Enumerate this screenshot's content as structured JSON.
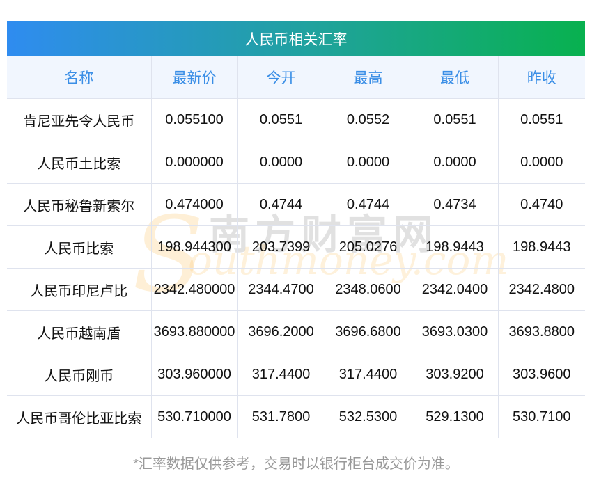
{
  "title": "人民币相关汇率",
  "columns": [
    "名称",
    "最新价",
    "今开",
    "最高",
    "最低",
    "昨收"
  ],
  "rows": [
    [
      "肯尼亚先令人民币",
      "0.055100",
      "0.0551",
      "0.0552",
      "0.0551",
      "0.0551"
    ],
    [
      "人民币土比索",
      "0.000000",
      "0.0000",
      "0.0000",
      "0.0000",
      "0.0000"
    ],
    [
      "人民币秘鲁新索尔",
      "0.474000",
      "0.4744",
      "0.4744",
      "0.4734",
      "0.4740"
    ],
    [
      "人民币比索",
      "198.944300",
      "203.7399",
      "205.0276",
      "198.9443",
      "198.9443"
    ],
    [
      "人民币印尼卢比",
      "2342.480000",
      "2344.4700",
      "2348.0600",
      "2342.0400",
      "2342.4800"
    ],
    [
      "人民币越南盾",
      "3693.880000",
      "3696.2000",
      "3696.6800",
      "3693.0300",
      "3693.8800"
    ],
    [
      "人民币刚币",
      "303.960000",
      "317.4400",
      "317.4400",
      "303.9200",
      "303.9600"
    ],
    [
      "人民币哥伦比亚比索",
      "530.710000",
      "531.7800",
      "532.5300",
      "529.1300",
      "530.7100"
    ]
  ],
  "footer": "*汇率数据仅供参考，交易时以银行柜台成交价为准。",
  "watermark": {
    "cn": "南方财富网",
    "en": "outhmoney.com",
    "s": "S"
  }
}
